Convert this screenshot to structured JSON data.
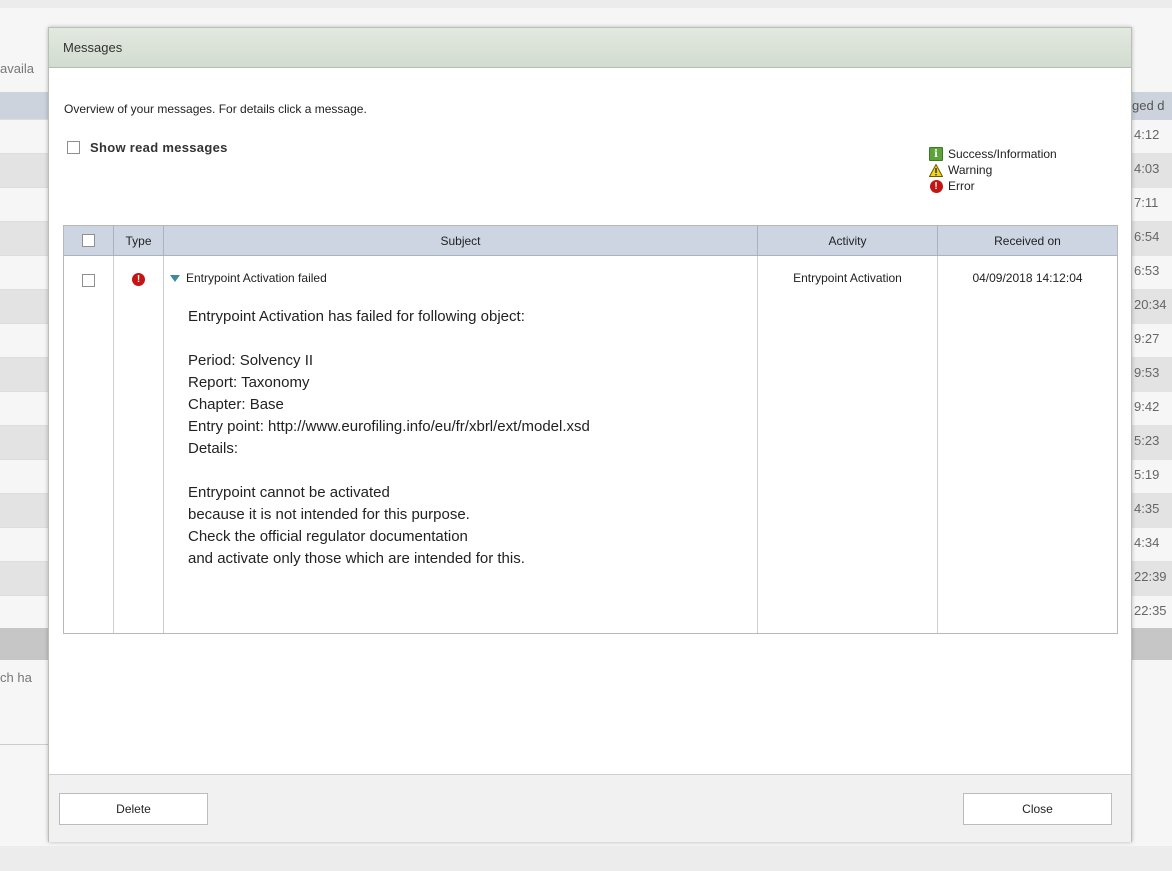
{
  "background": {
    "left_text": "availa",
    "bottom_text": "ch ha",
    "right_header": "ged d",
    "right_values": [
      "4:12",
      "4:03",
      "7:11",
      "6:54",
      "6:53",
      "20:34",
      "9:27",
      "9:53",
      "9:42",
      "5:23",
      "5:19",
      "4:35",
      "4:34",
      "22:39",
      "22:35"
    ]
  },
  "modal": {
    "title": "Messages",
    "intro": "Overview of your messages. For details click a message.",
    "show_read_label": "Show read messages",
    "legend": {
      "success": "Success/Information",
      "warning": "Warning",
      "error": "Error"
    },
    "table": {
      "headers": {
        "type": "Type",
        "subject": "Subject",
        "activity": "Activity",
        "received": "Received on"
      },
      "rows": [
        {
          "type_icon": "error-icon",
          "subject": "Entrypoint Activation failed",
          "activity": "Entrypoint Activation",
          "received": "04/09/2018 14:12:04",
          "details": {
            "line1": "Entrypoint Activation has failed for following object:",
            "period": "Period: Solvency II",
            "report": "Report: Taxonomy",
            "chapter": "Chapter: Base",
            "entry_point": "Entry point: http://www.eurofiling.info/eu/fr/xbrl/ext/model.xsd",
            "details_label": "Details:",
            "msg1": "Entrypoint cannot be activated",
            "msg2": "because it is not intended for this purpose.",
            "msg3": "Check the official regulator documentation",
            "msg4": "and activate only those which are intended for this."
          }
        }
      ]
    },
    "buttons": {
      "delete": "Delete",
      "close": "Close"
    }
  },
  "colors": {
    "header_bg": "#cdd5e2",
    "title_bg": "#dce4da",
    "error": "#c41414",
    "info": "#5aa43a",
    "warning": "#f1d51c"
  }
}
